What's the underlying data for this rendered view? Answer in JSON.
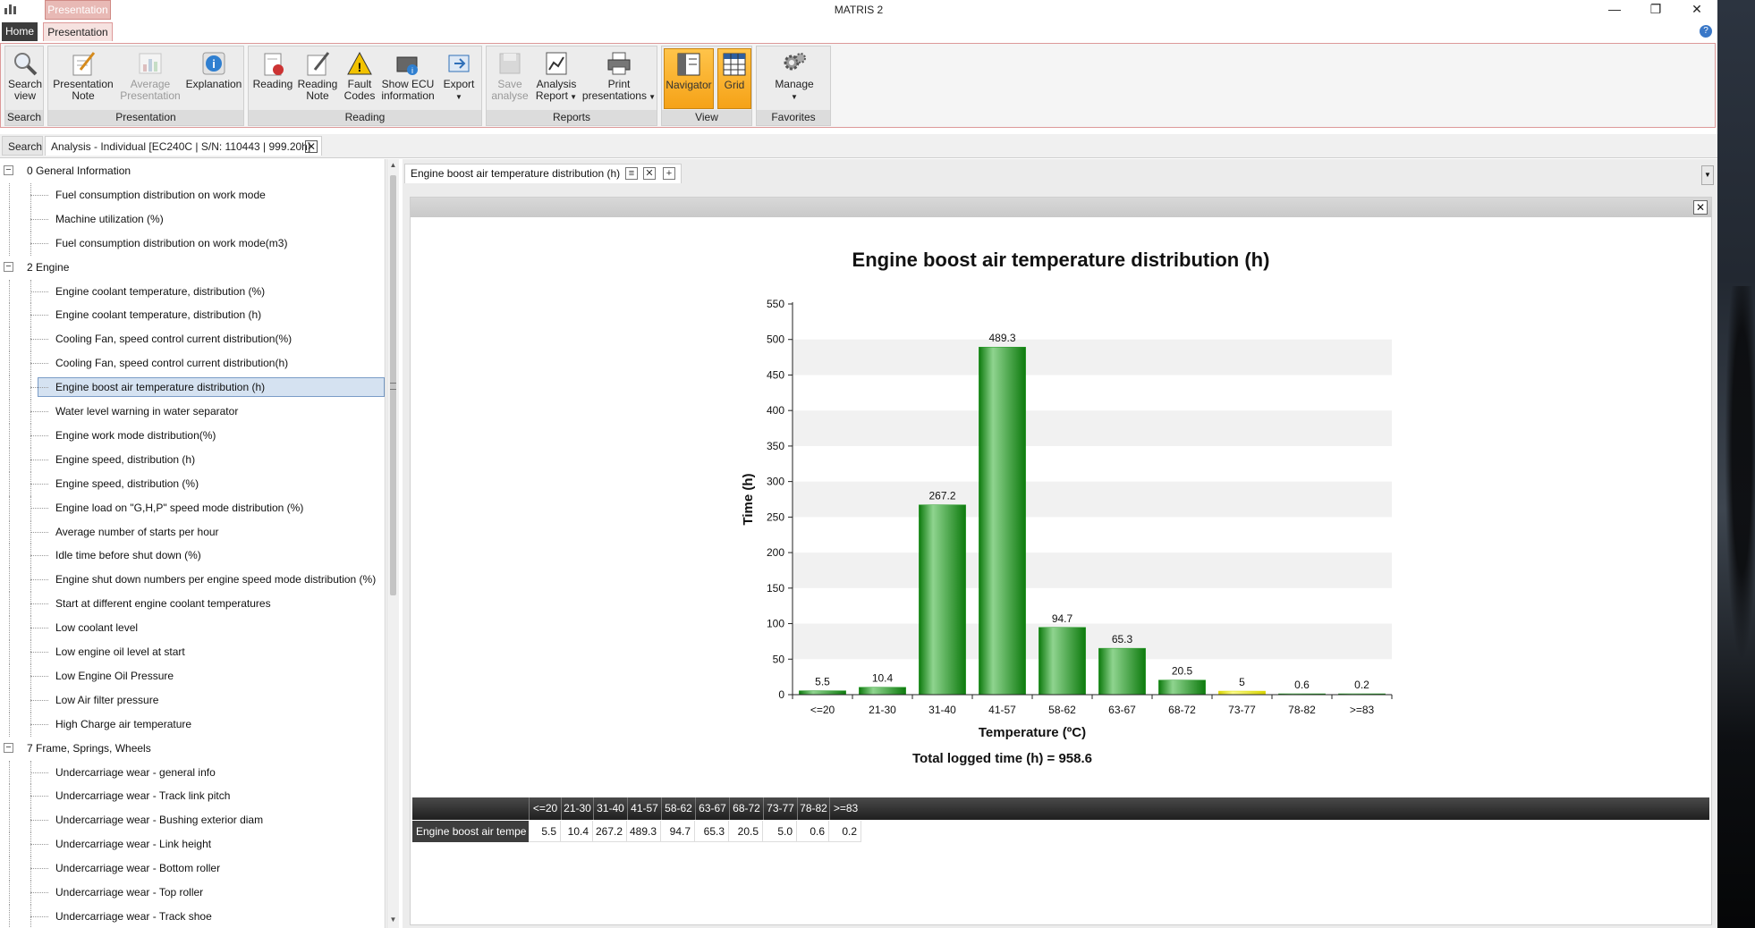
{
  "window": {
    "title": "MATRIS 2",
    "context_tab": "Presentation",
    "controls": [
      "—",
      "❐",
      "✕"
    ]
  },
  "ribbon": {
    "tabs": [
      "Home",
      "Presentation"
    ],
    "groups": [
      {
        "label": "Search",
        "buttons": [
          {
            "label": "Search\nview",
            "icon": "search-icon"
          }
        ]
      },
      {
        "label": "Presentation",
        "buttons": [
          {
            "label": "Presentation\nNote",
            "icon": "note-icon"
          },
          {
            "label": "Average\nPresentation",
            "icon": "average-icon",
            "disabled": true
          },
          {
            "label": "Explanation",
            "icon": "info-icon"
          }
        ]
      },
      {
        "label": "Reading",
        "buttons": [
          {
            "label": "Reading",
            "icon": "reading-icon"
          },
          {
            "label": "Reading\nNote",
            "icon": "reading-note-icon"
          },
          {
            "label": "Fault\nCodes",
            "icon": "warning-icon"
          },
          {
            "label": "Show ECU\ninformation",
            "icon": "ecu-icon"
          },
          {
            "label": "Export",
            "icon": "export-icon"
          }
        ]
      },
      {
        "label": "Reports",
        "buttons": [
          {
            "label": "Save\nanalyse",
            "icon": "save-icon",
            "disabled": true
          },
          {
            "label": "Analysis\nReport",
            "icon": "report-icon"
          },
          {
            "label": "Print\npresentations",
            "icon": "print-icon"
          }
        ]
      },
      {
        "label": "View",
        "buttons": [
          {
            "label": "Navigator",
            "icon": "navigator-icon",
            "active": true
          },
          {
            "label": "Grid",
            "icon": "grid-icon",
            "active": true
          }
        ]
      },
      {
        "label": "Favorites",
        "buttons": [
          {
            "label": "Manage",
            "icon": "gear-icon"
          }
        ]
      }
    ]
  },
  "doc_tabs": {
    "search": "Search",
    "analysis": "Analysis - Individual [EC240C | S/N: 110443 | 999.20h]"
  },
  "tree": [
    {
      "type": "cat",
      "label": "0 General Information"
    },
    {
      "type": "leaf",
      "label": "Fuel consumption distribution on work mode"
    },
    {
      "type": "leaf",
      "label": "Machine utilization (%)"
    },
    {
      "type": "leaf",
      "label": "Fuel consumption distribution on work mode(m3)"
    },
    {
      "type": "cat",
      "label": "2 Engine"
    },
    {
      "type": "leaf",
      "label": "Engine coolant temperature, distribution (%)"
    },
    {
      "type": "leaf",
      "label": "Engine coolant temperature, distribution (h)"
    },
    {
      "type": "leaf",
      "label": "Cooling Fan, speed control current distribution(%)"
    },
    {
      "type": "leaf",
      "label": "Cooling Fan, speed control current distribution(h)"
    },
    {
      "type": "leaf",
      "label": "Engine boost air temperature distribution (h)",
      "selected": true
    },
    {
      "type": "leaf",
      "label": "Water level warning in water separator"
    },
    {
      "type": "leaf",
      "label": "Engine work mode distribution(%)"
    },
    {
      "type": "leaf",
      "label": "Engine speed, distribution (h)"
    },
    {
      "type": "leaf",
      "label": "Engine speed, distribution (%)"
    },
    {
      "type": "leaf",
      "label": "Engine load on \"G,H,P\" speed mode distribution (%)"
    },
    {
      "type": "leaf",
      "label": "Average number of starts per hour"
    },
    {
      "type": "leaf",
      "label": "Idle time before shut down (%)"
    },
    {
      "type": "leaf",
      "label": "Engine shut down numbers per engine speed mode distribution (%)"
    },
    {
      "type": "leaf",
      "label": "Start at different engine coolant temperatures"
    },
    {
      "type": "leaf",
      "label": "Low coolant level"
    },
    {
      "type": "leaf",
      "label": "Low engine oil level at start"
    },
    {
      "type": "leaf",
      "label": "Low Engine Oil Pressure"
    },
    {
      "type": "leaf",
      "label": "Low Air filter pressure"
    },
    {
      "type": "leaf",
      "label": "High Charge air temperature"
    },
    {
      "type": "cat",
      "label": "7 Frame, Springs, Wheels"
    },
    {
      "type": "leaf",
      "label": "Undercarriage wear - general info"
    },
    {
      "type": "leaf",
      "label": "Undercarriage wear - Track link pitch"
    },
    {
      "type": "leaf",
      "label": "Undercarriage wear - Bushing exterior diam"
    },
    {
      "type": "leaf",
      "label": "Undercarriage wear - Link height"
    },
    {
      "type": "leaf",
      "label": "Undercarriage wear - Bottom roller"
    },
    {
      "type": "leaf",
      "label": "Undercarriage wear - Top roller"
    },
    {
      "type": "leaf",
      "label": "Undercarriage wear - Track shoe"
    }
  ],
  "content_tab": {
    "label": "Engine boost air temperature distribution (h)"
  },
  "chart_data": {
    "type": "bar",
    "title": "Engine boost air temperature distribution (h)",
    "xlabel": "Temperature (ºC)",
    "ylabel": "Time (h)",
    "footer": "Total logged time (h) = 958.6",
    "categories": [
      "<=20",
      "21-30",
      "31-40",
      "41-57",
      "58-62",
      "63-67",
      "68-72",
      "73-77",
      "78-82",
      ">=83"
    ],
    "values": [
      5.5,
      10.4,
      267.2,
      489.3,
      94.7,
      65.3,
      20.5,
      5,
      0.6,
      0.2
    ],
    "value_labels": [
      "5.5",
      "10.4",
      "267.2",
      "489.3",
      "94.7",
      "65.3",
      "20.5",
      "5",
      "0.6",
      "0.2"
    ],
    "bar_colors": [
      "#1f9a1f",
      "#1f9a1f",
      "#1f9a1f",
      "#1f9a1f",
      "#1f9a1f",
      "#1f9a1f",
      "#1f9a1f",
      "#e3e000",
      "#1f9a1f",
      "#1f9a1f"
    ],
    "ylim": [
      0,
      550
    ],
    "yticks": [
      0,
      50,
      100,
      150,
      200,
      250,
      300,
      350,
      400,
      450,
      500,
      550
    ],
    "grid": "alternating bands"
  },
  "data_grid": {
    "headers": [
      "<=20",
      "21-30",
      "31-40",
      "41-57",
      "58-62",
      "63-67",
      "68-72",
      "73-77",
      "78-82",
      ">=83"
    ],
    "row_label": "Engine boost air tempe",
    "row_values": [
      "5.5",
      "10.4",
      "267.2",
      "489.3",
      "94.7",
      "65.3",
      "20.5",
      "5.0",
      "0.6",
      "0.2"
    ]
  }
}
